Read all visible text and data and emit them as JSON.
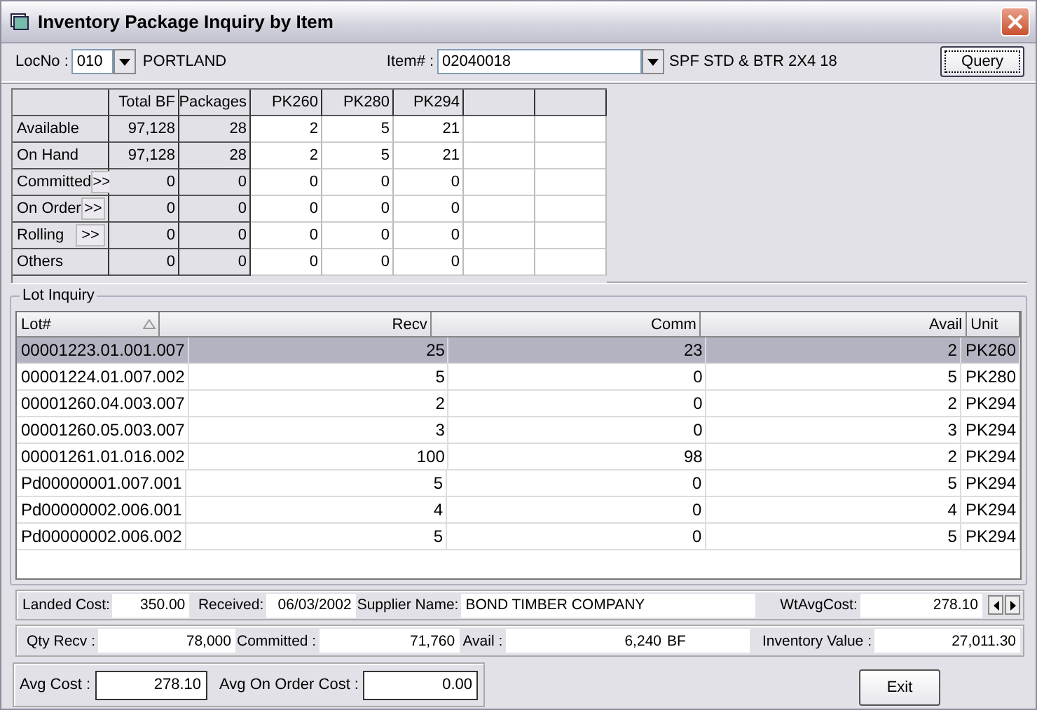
{
  "window": {
    "title": "Inventory Package Inquiry by Item"
  },
  "location": {
    "label": "LocNo :",
    "value": "010",
    "name": "PORTLAND"
  },
  "item": {
    "label": "Item# :",
    "value": "02040018",
    "description": "SPF STD & BTR  2X4 18"
  },
  "query_button": "Query",
  "summary": {
    "columns": [
      "Total BF",
      "Packages",
      "PK260",
      "PK280",
      "PK294"
    ],
    "rows": [
      {
        "label": "Available",
        "values": [
          "97,128",
          "28",
          "2",
          "5",
          "21"
        ]
      },
      {
        "label": "On Hand",
        "values": [
          "97,128",
          "28",
          "2",
          "5",
          "21"
        ]
      },
      {
        "label": "Committed",
        "detail": ">>",
        "values": [
          "0",
          "0",
          "0",
          "0",
          "0"
        ]
      },
      {
        "label": "On Order",
        "detail": ">>",
        "values": [
          "0",
          "0",
          "0",
          "0",
          "0"
        ]
      },
      {
        "label": "Rolling",
        "detail": ">>",
        "values": [
          "0",
          "0",
          "0",
          "0",
          "0"
        ]
      },
      {
        "label": "Others",
        "values": [
          "0",
          "0",
          "0",
          "0",
          "0"
        ]
      }
    ]
  },
  "lot_inquiry": {
    "title": "Lot Inquiry",
    "columns": [
      "Lot#",
      "Recv",
      "Comm",
      "Avail",
      "Unit"
    ],
    "rows": [
      {
        "cells": [
          "00001223.01.001.007",
          "25",
          "23",
          "2",
          "PK260"
        ],
        "selected": true
      },
      {
        "cells": [
          "00001224.01.007.002",
          "5",
          "0",
          "5",
          "PK280"
        ],
        "selected": false
      },
      {
        "cells": [
          "00001260.04.003.007",
          "2",
          "0",
          "2",
          "PK294"
        ],
        "selected": false
      },
      {
        "cells": [
          "00001260.05.003.007",
          "3",
          "0",
          "3",
          "PK294"
        ],
        "selected": false
      },
      {
        "cells": [
          "00001261.01.016.002",
          "100",
          "98",
          "2",
          "PK294"
        ],
        "selected": false
      },
      {
        "cells": [
          "Pd00000001.007.001",
          "5",
          "0",
          "5",
          "PK294"
        ],
        "selected": false
      },
      {
        "cells": [
          "Pd00000002.006.001",
          "4",
          "0",
          "4",
          "PK294"
        ],
        "selected": false
      },
      {
        "cells": [
          "Pd00000002.006.002",
          "5",
          "0",
          "5",
          "PK294"
        ],
        "selected": false
      }
    ]
  },
  "lot_details": [
    {
      "label": "Landed Cost:",
      "value": "350.00"
    },
    {
      "label": "Received:",
      "value": "06/03/2002"
    },
    {
      "label": "Supplier Name:",
      "value": "BOND TIMBER COMPANY"
    },
    {
      "label": "WtAvgCost:",
      "value": "278.10"
    }
  ],
  "totals": [
    {
      "label": "Qty Recv :",
      "value": "78,000"
    },
    {
      "label": "Committed :",
      "value": "71,760"
    },
    {
      "label": "Avail :",
      "value": "6,240",
      "unit": "BF"
    },
    {
      "label": "Inventory Value :",
      "value": "27,011.30"
    }
  ],
  "costs": [
    {
      "label": "Avg Cost :",
      "value": "278.10"
    },
    {
      "label": "Avg On Order Cost :",
      "value": "0.00"
    }
  ],
  "exit_button": "Exit"
}
